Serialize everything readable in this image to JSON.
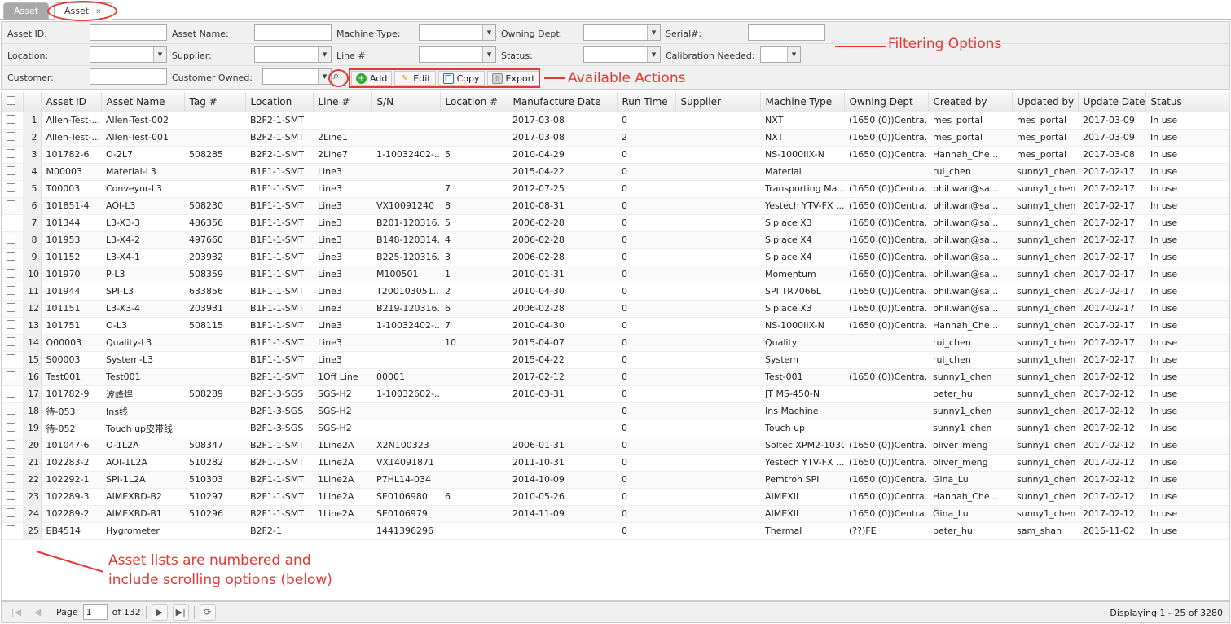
{
  "tabs": [
    {
      "label": "Asset"
    },
    {
      "label": "Asset",
      "close": "✕"
    }
  ],
  "filters": {
    "asset_id": "Asset ID:",
    "asset_name": "Asset Name:",
    "machine_type": "Machine Type:",
    "owning_dept": "Owning Dept:",
    "serial": "Serial#:",
    "location": "Location:",
    "supplier": "Supplier:",
    "line": "Line #:",
    "status": "Status:",
    "calibration": "Calibration Needed:",
    "customer": "Customer:",
    "customer_owned": "Customer Owned:"
  },
  "actions": {
    "add": "Add",
    "edit": "Edit",
    "copy": "Copy",
    "export": "Export"
  },
  "columns": [
    "Asset ID",
    "Asset Name",
    "Tag #",
    "Location",
    "Line #",
    "S/N",
    "Location #",
    "Manufacture Date",
    "Run Time",
    "Supplier",
    "Machine Type",
    "Owning Dept",
    "Created by",
    "Updated by",
    "Update Date",
    "Status"
  ],
  "rows": [
    [
      "Allen-Test-...",
      "Allen-Test-002",
      "",
      "B2F2-1-SMT",
      "",
      "",
      "",
      "2017-03-08",
      "0",
      "",
      "NXT",
      "(1650 (0))Centra...",
      "mes_portal",
      "mes_portal",
      "2017-03-09",
      "In use"
    ],
    [
      "Allen-Test-...",
      "Allen-Test-001",
      "",
      "B2F2-1-SMT",
      "2Line1",
      "",
      "",
      "2017-03-08",
      "2",
      "",
      "NXT",
      "(1650 (0))Centra...",
      "mes_portal",
      "mes_portal",
      "2017-03-09",
      "In use"
    ],
    [
      "101782-6",
      "O-2L7",
      "508285",
      "B2F2-1-SMT",
      "2Line7",
      "1-10032402-...",
      "5",
      "2010-04-29",
      "0",
      "",
      "NS-1000IIX-N",
      "(1650 (0))Centra...",
      "Hannah_Che...",
      "mes_portal",
      "2017-03-08",
      "In use"
    ],
    [
      "M00003",
      "Material-L3",
      "",
      "B1F1-1-SMT",
      "Line3",
      "",
      "",
      "2015-04-22",
      "0",
      "",
      "Material",
      "",
      "rui_chen",
      "sunny1_chen",
      "2017-02-17",
      "In use"
    ],
    [
      "T00003",
      "Conveyor-L3",
      "",
      "B1F1-1-SMT",
      "Line3",
      "",
      "7",
      "2012-07-25",
      "0",
      "",
      "Transporting Ma...",
      "(1650 (0))Centra...",
      "phil.wan@sa...",
      "sunny1_chen",
      "2017-02-17",
      "In use"
    ],
    [
      "101851-4",
      "AOI-L3",
      "508230",
      "B1F1-1-SMT",
      "Line3",
      "VX10091240",
      "8",
      "2010-08-31",
      "0",
      "",
      "Yestech YTV-FX ...",
      "(1650 (0))Centra...",
      "phil.wan@sa...",
      "sunny1_chen",
      "2017-02-17",
      "In use"
    ],
    [
      "101344",
      "L3-X3-3",
      "486356",
      "B1F1-1-SMT",
      "Line3",
      "B201-120316...",
      "5",
      "2006-02-28",
      "0",
      "",
      "Siplace X3",
      "(1650 (0))Centra...",
      "phil.wan@sa...",
      "sunny1_chen",
      "2017-02-17",
      "In use"
    ],
    [
      "101953",
      "L3-X4-2",
      "497660",
      "B1F1-1-SMT",
      "Line3",
      "B148-120314...",
      "4",
      "2006-02-28",
      "0",
      "",
      "Siplace X4",
      "(1650 (0))Centra...",
      "phil.wan@sa...",
      "sunny1_chen",
      "2017-02-17",
      "In use"
    ],
    [
      "101152",
      "L3-X4-1",
      "203932",
      "B1F1-1-SMT",
      "Line3",
      "B225-120316...",
      "3",
      "2006-02-28",
      "0",
      "",
      "Siplace X4",
      "(1650 (0))Centra...",
      "phil.wan@sa...",
      "sunny1_chen",
      "2017-02-17",
      "In use"
    ],
    [
      "101970",
      "P-L3",
      "508359",
      "B1F1-1-SMT",
      "Line3",
      "M100501",
      "1",
      "2010-01-31",
      "0",
      "",
      "Momentum",
      "(1650 (0))Centra...",
      "phil.wan@sa...",
      "sunny1_chen",
      "2017-02-17",
      "In use"
    ],
    [
      "101944",
      "SPI-L3",
      "633856",
      "B1F1-1-SMT",
      "Line3",
      "T200103051...",
      "2",
      "2010-04-30",
      "0",
      "",
      "SPI TR7066L",
      "(1650 (0))Centra...",
      "phil.wan@sa...",
      "sunny1_chen",
      "2017-02-17",
      "In use"
    ],
    [
      "101151",
      "L3-X3-4",
      "203931",
      "B1F1-1-SMT",
      "Line3",
      "B219-120316...",
      "6",
      "2006-02-28",
      "0",
      "",
      "Siplace X3",
      "(1650 (0))Centra...",
      "phil.wan@sa...",
      "sunny1_chen",
      "2017-02-17",
      "In use"
    ],
    [
      "101751",
      "O-L3",
      "508115",
      "B1F1-1-SMT",
      "Line3",
      "1-10032402-...",
      "7",
      "2010-04-30",
      "0",
      "",
      "NS-1000IIX-N",
      "(1650 (0))Centra...",
      "Hannah_Che...",
      "sunny1_chen",
      "2017-02-17",
      "In use"
    ],
    [
      "Q00003",
      "Quality-L3",
      "",
      "B1F1-1-SMT",
      "Line3",
      "",
      "10",
      "2015-04-07",
      "0",
      "",
      "Quality",
      "",
      "rui_chen",
      "sunny1_chen",
      "2017-02-17",
      "In use"
    ],
    [
      "S00003",
      "System-L3",
      "",
      "B1F1-1-SMT",
      "Line3",
      "",
      "",
      "2015-04-22",
      "0",
      "",
      "System",
      "",
      "rui_chen",
      "sunny1_chen",
      "2017-02-17",
      "In use"
    ],
    [
      "Test001",
      "Test001",
      "",
      "B2F1-1-SMT",
      "1Off Line",
      "00001",
      "",
      "2017-02-12",
      "0",
      "",
      "Test-001",
      "(1650 (0))Centra...",
      "sunny1_chen",
      "sunny1_chen",
      "2017-02-12",
      "In use"
    ],
    [
      "101782-9",
      "波峰焊",
      "508289",
      "B2F1-3-SGS",
      "SGS-H2",
      "1-10032602-...",
      "",
      "2010-03-31",
      "0",
      "",
      "JT MS-450-N",
      "",
      "peter_hu",
      "sunny1_chen",
      "2017-02-12",
      "In use"
    ],
    [
      "待-053",
      "Ins线",
      "",
      "B2F1-3-SGS",
      "SGS-H2",
      "",
      "",
      "",
      "0",
      "",
      "Ins Machine",
      "",
      "sunny1_chen",
      "sunny1_chen",
      "2017-02-12",
      "In use"
    ],
    [
      "待-052",
      "Touch up皮带线",
      "",
      "B2F1-3-SGS",
      "SGS-H2",
      "",
      "",
      "",
      "0",
      "",
      "Touch up",
      "",
      "sunny1_chen",
      "sunny1_chen",
      "2017-02-12",
      "In use"
    ],
    [
      "101047-6",
      "O-1L2A",
      "508347",
      "B2F1-1-SMT",
      "1Line2A",
      "X2N100323",
      "",
      "2006-01-31",
      "0",
      "",
      "Soltec XPM2-1030",
      "(1650 (0))Centra...",
      "oliver_meng",
      "sunny1_chen",
      "2017-02-12",
      "In use"
    ],
    [
      "102283-2",
      "AOI-1L2A",
      "510282",
      "B2F1-1-SMT",
      "1Line2A",
      "VX14091871",
      "",
      "2011-10-31",
      "0",
      "",
      "Yestech YTV-FX ...",
      "(1650 (0))Centra...",
      "oliver_meng",
      "sunny1_chen",
      "2017-02-12",
      "In use"
    ],
    [
      "102292-1",
      "SPI-1L2A",
      "510303",
      "B2F1-1-SMT",
      "1Line2A",
      "P7HL14-034",
      "",
      "2014-10-09",
      "0",
      "",
      "Pemtron SPI",
      "(1650 (0))Centra...",
      "Gina_Lu",
      "sunny1_chen",
      "2017-02-12",
      "In use"
    ],
    [
      "102289-3",
      "AIMEXBD-B2",
      "510297",
      "B2F1-1-SMT",
      "1Line2A",
      "SE0106980",
      "6",
      "2010-05-26",
      "0",
      "",
      "AIMEXII",
      "(1650 (0))Centra...",
      "Hannah_Che...",
      "sunny1_chen",
      "2017-02-12",
      "In use"
    ],
    [
      "102289-2",
      "AIMEXBD-B1",
      "510296",
      "B2F1-1-SMT",
      "1Line2A",
      "SE0106979",
      "",
      "2014-11-09",
      "0",
      "",
      "AIMEXII",
      "(1650 (0))Centra...",
      "Gina_Lu",
      "sunny1_chen",
      "2017-02-12",
      "In use"
    ],
    [
      "EB4514",
      "Hygrometer",
      "",
      "B2F2-1",
      "",
      "1441396296",
      "",
      "",
      "0",
      "",
      "Thermal",
      "(??)FE",
      "peter_hu",
      "sam_shan",
      "2016-11-02",
      "In use"
    ]
  ],
  "pager": {
    "page_label": "Page",
    "page": "1",
    "of": "of 132",
    "display": "Displaying 1 - 25 of 3280"
  },
  "annotations": {
    "filtering": "Filtering Options",
    "actions": "Available Actions",
    "list_note_1": "Asset lists are numbered and",
    "list_note_2": "include scrolling options (below)"
  },
  "colors": {
    "annotation": "#e53935"
  }
}
